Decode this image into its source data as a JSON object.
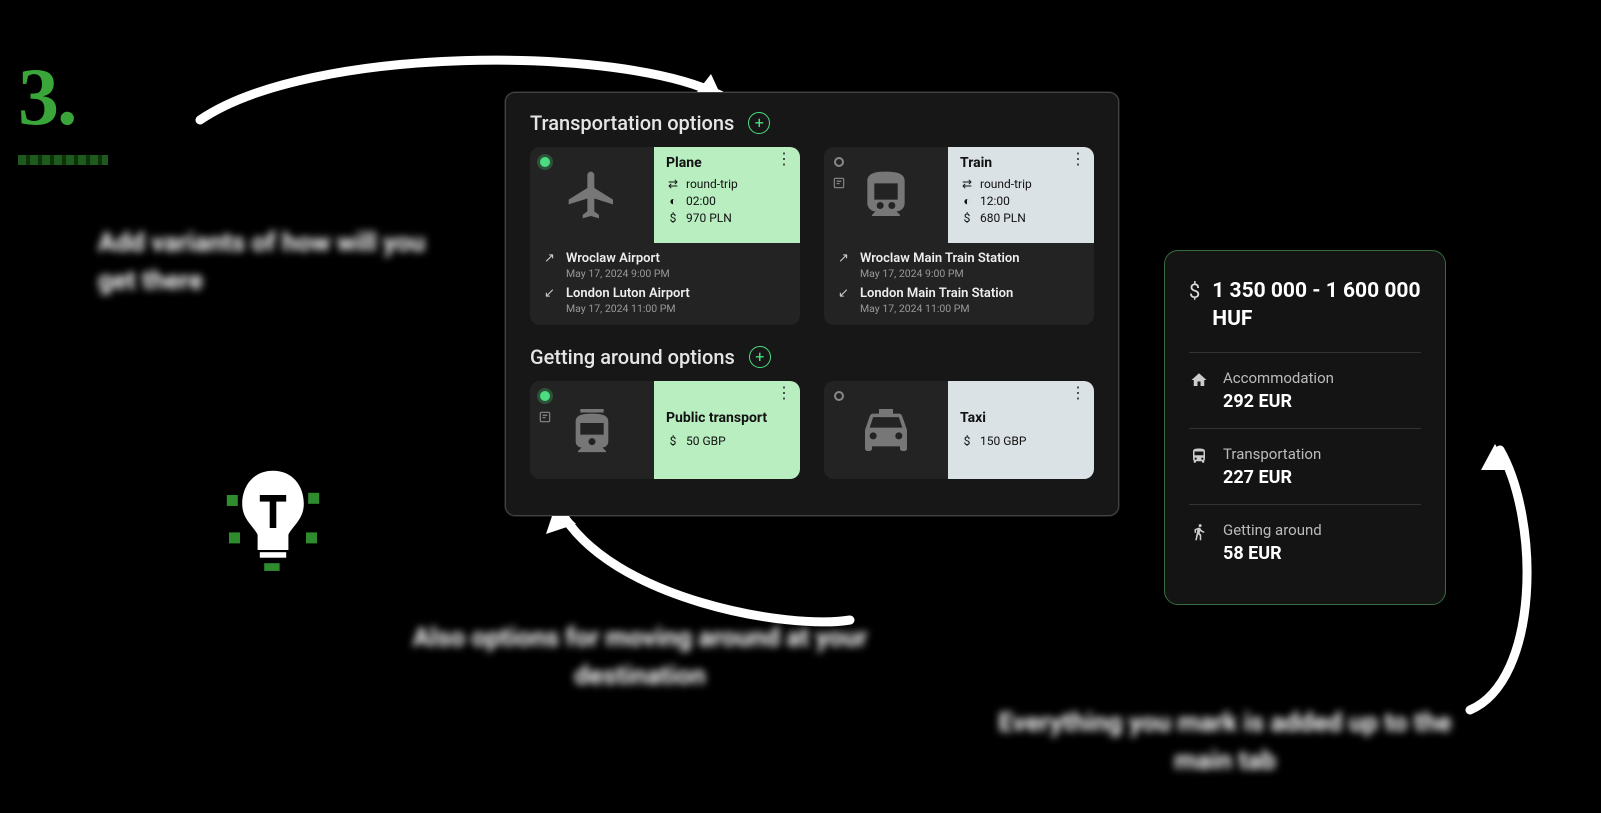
{
  "step_number": "3.",
  "captions": {
    "c1": "Add variants of how will you get there",
    "c2": "Also options for moving around at your destination",
    "c3": "Everything you mark is added up to the main tab"
  },
  "panel": {
    "sections": {
      "transport": {
        "title": "Transportation options",
        "cards": [
          {
            "status": "filled",
            "info_variant": "green",
            "type_label": "Plane",
            "trip_type": "round-trip",
            "duration": "02:00",
            "price": "970 PLN",
            "origin": {
              "name": "Wroclaw Airport",
              "date": "May 17, 2024 9:00 PM"
            },
            "destination": {
              "name": "London Luton Airport",
              "date": "May 17, 2024 11:00 PM"
            }
          },
          {
            "status": "empty",
            "info_variant": "grey",
            "type_label": "Train",
            "trip_type": "round-trip",
            "duration": "12:00",
            "price": "680 PLN",
            "origin": {
              "name": "Wroclaw Main Train Station",
              "date": "May 17, 2024 9:00 PM"
            },
            "destination": {
              "name": "London Main Train Station",
              "date": "May 17, 2024 11:00 PM"
            }
          }
        ]
      },
      "getting_around": {
        "title": "Getting around options",
        "cards": [
          {
            "status": "filled",
            "info_variant": "green",
            "type_label": "Public transport",
            "price": "50 GBP"
          },
          {
            "status": "empty",
            "info_variant": "grey",
            "type_label": "Taxi",
            "price": "150 GBP"
          }
        ]
      }
    }
  },
  "budget": {
    "total": "1 350 000 - 1 600 000 HUF",
    "lines": [
      {
        "label": "Accommodation",
        "value": "292 EUR"
      },
      {
        "label": "Transportation",
        "value": "227 EUR"
      },
      {
        "label": "Getting around",
        "value": "58 EUR"
      }
    ]
  }
}
